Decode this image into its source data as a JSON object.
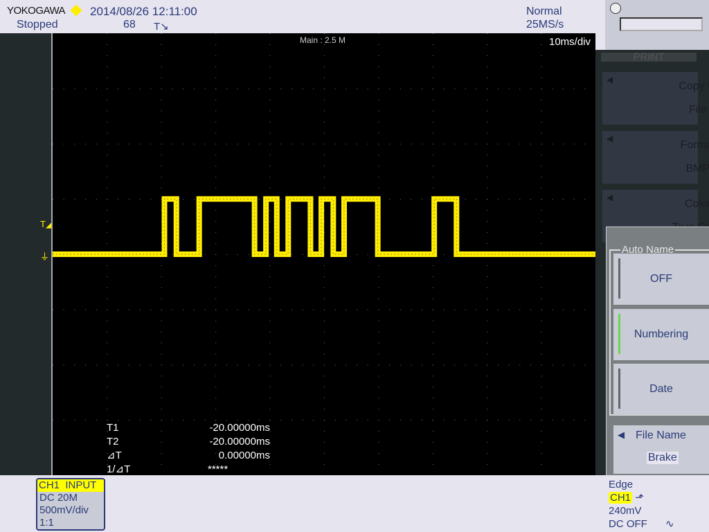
{
  "header": {
    "brand": "YOKOGAWA",
    "datetime": "2014/08/26 12:11:00",
    "status": "Stopped",
    "acq_count": "68",
    "trigger_icon": "trigger-position-icon",
    "mode": "Normal",
    "sample_rate": "25MS/s"
  },
  "display": {
    "main_label": "Main : 2.5 M",
    "time_div": "10ms/div",
    "trace_color": "#ffee00"
  },
  "print_menu": {
    "title": "PRINT",
    "buttons": [
      {
        "label": "Copy to",
        "value": "File"
      },
      {
        "label": "Format",
        "value": "BMP"
      },
      {
        "label": "Color",
        "value": "True Color"
      }
    ]
  },
  "auto_name": {
    "title": "Auto Name",
    "options": [
      {
        "label": "OFF",
        "selected": false
      },
      {
        "label": "Numbering",
        "selected": true
      },
      {
        "label": "Date",
        "selected": false
      }
    ]
  },
  "file_name": {
    "label": "File Name",
    "value": "Brake"
  },
  "measurements": [
    {
      "label": "T1",
      "value": "-20.00000ms"
    },
    {
      "label": "T2",
      "value": "-20.00000ms"
    },
    {
      "label": "⊿T",
      "value": "0.00000ms"
    },
    {
      "label": "1/⊿T",
      "value": "*****"
    }
  ],
  "ch1": {
    "header": "CH1  INPUT",
    "coupling": "DC 20M",
    "scale": "500mV/div",
    "probe": "1:1"
  },
  "trigger": {
    "type": "Edge",
    "source": "CH1",
    "level": "240mV",
    "filter": "DC OFF",
    "slope_icon": "rising-edge-icon",
    "filter_icon": "noise-filter-icon"
  },
  "chart_data": {
    "type": "line",
    "xunit": "ms",
    "xlim": [
      -20,
      80
    ],
    "ylim_div": [
      -4,
      4
    ],
    "low_level_div": 0,
    "high_level_div": 1,
    "pulses_ms": [
      [
        0.6,
        2.8
      ],
      [
        7.0,
        17.2
      ],
      [
        19.3,
        21.3
      ],
      [
        23.4,
        27.5
      ],
      [
        29.5,
        31.7
      ],
      [
        33.7,
        39.9
      ],
      [
        50.3,
        54.4
      ]
    ]
  }
}
